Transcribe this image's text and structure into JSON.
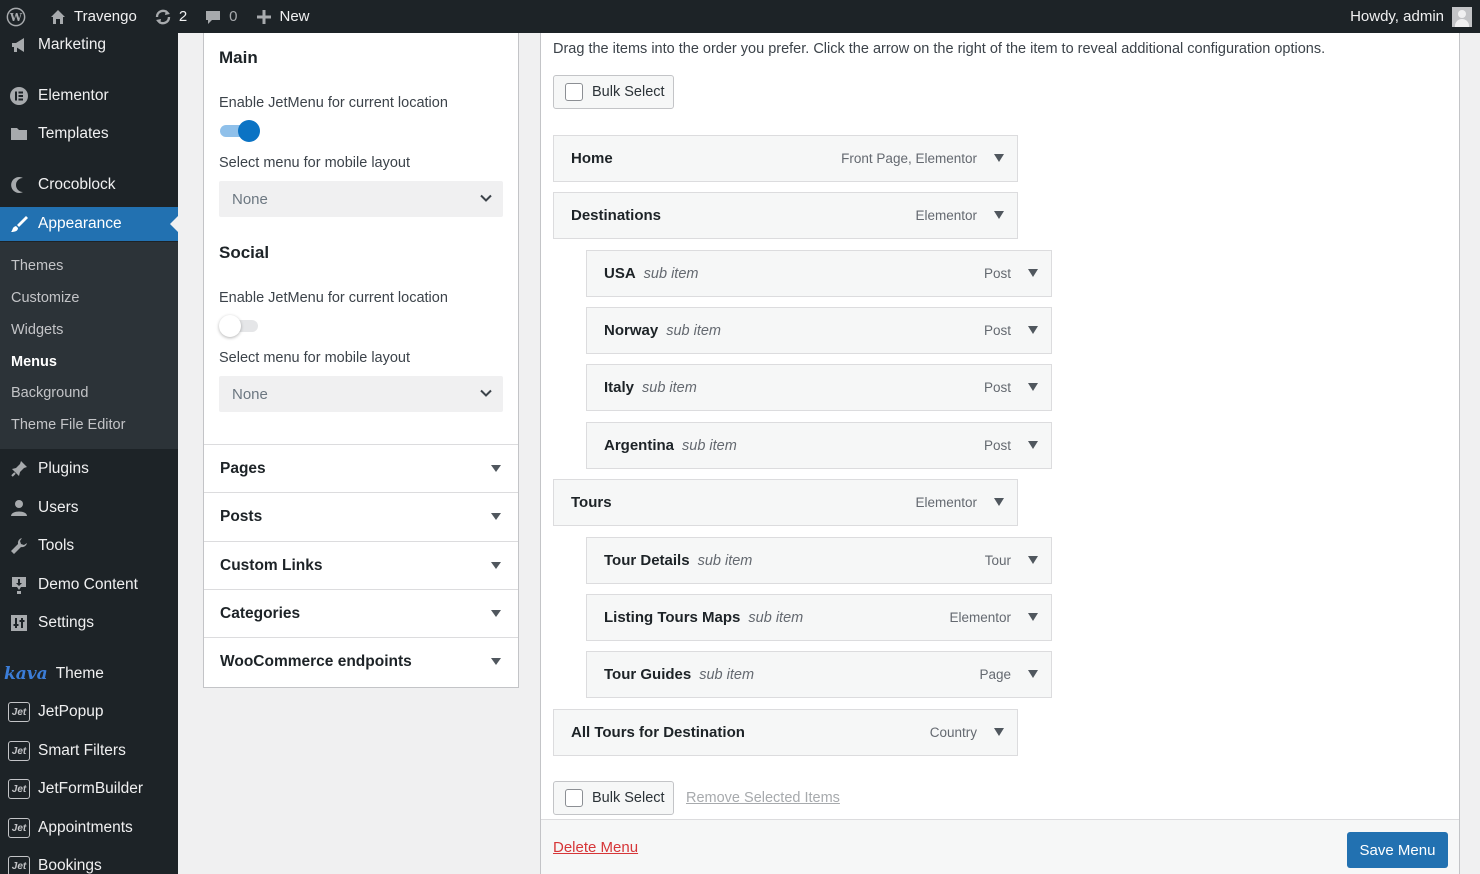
{
  "adminbar": {
    "site_name": "Travengo",
    "updates_count": "2",
    "comments_count": "0",
    "new_label": "New",
    "greeting": "Howdy, admin"
  },
  "sidebar": {
    "items": [
      {
        "label": "Marketing",
        "icon": "megaphone-icon"
      },
      {
        "label": "Elementor",
        "icon": "elementor-icon"
      },
      {
        "label": "Templates",
        "icon": "folder-icon"
      },
      {
        "label": "Crocoblock",
        "icon": "crocoblock-icon"
      },
      {
        "label": "Appearance",
        "icon": "paintbrush-icon"
      },
      {
        "label": "Plugins",
        "icon": "plugin-icon"
      },
      {
        "label": "Users",
        "icon": "user-icon"
      },
      {
        "label": "Tools",
        "icon": "wrench-icon"
      },
      {
        "label": "Demo Content",
        "icon": "download-icon"
      },
      {
        "label": "Settings",
        "icon": "settings-icon"
      },
      {
        "label": "Theme",
        "logo": "kava"
      },
      {
        "label": "JetPopup",
        "badge": "Jet"
      },
      {
        "label": "Smart Filters",
        "badge": "Jet"
      },
      {
        "label": "JetFormBuilder",
        "badge": "Jet"
      },
      {
        "label": "Appointments",
        "badge": "Jet"
      },
      {
        "label": "Bookings",
        "badge": "Jet"
      }
    ],
    "submenu": [
      "Themes",
      "Customize",
      "Widgets",
      "Menus",
      "Background",
      "Theme File Editor"
    ],
    "active": "Appearance",
    "current_sub": "Menus"
  },
  "locations": [
    {
      "title": "Main",
      "enable_label": "Enable JetMenu for current location",
      "enabled": true,
      "mobile_label": "Select menu for mobile layout",
      "mobile_value": "None"
    },
    {
      "title": "Social",
      "enable_label": "Enable JetMenu for current location",
      "enabled": false,
      "mobile_label": "Select menu for mobile layout",
      "mobile_value": "None"
    }
  ],
  "accordion": [
    "Pages",
    "Posts",
    "Custom Links",
    "Categories",
    "WooCommerce endpoints"
  ],
  "menu_editor": {
    "instructions": "Drag the items into the order you prefer. Click the arrow on the right of the item to reveal additional configuration options.",
    "bulk_select_label": "Bulk Select",
    "remove_selected_label": "Remove Selected Items",
    "delete_menu_label": "Delete Menu",
    "save_menu_label": "Save Menu",
    "items": [
      {
        "title": "Home",
        "sub": "",
        "type": "Front Page, Elementor",
        "depth": 0
      },
      {
        "title": "Destinations",
        "sub": "",
        "type": "Elementor",
        "depth": 0
      },
      {
        "title": "USA",
        "sub": "sub item",
        "type": "Post",
        "depth": 1
      },
      {
        "title": "Norway",
        "sub": "sub item",
        "type": "Post",
        "depth": 1
      },
      {
        "title": "Italy",
        "sub": "sub item",
        "type": "Post",
        "depth": 1
      },
      {
        "title": "Argentina",
        "sub": "sub item",
        "type": "Post",
        "depth": 1
      },
      {
        "title": "Tours",
        "sub": "",
        "type": "Elementor",
        "depth": 0
      },
      {
        "title": "Tour Details",
        "sub": "sub item",
        "type": "Tour",
        "depth": 1
      },
      {
        "title": "Listing Tours Maps",
        "sub": "sub item",
        "type": "Elementor",
        "depth": 1
      },
      {
        "title": "Tour Guides",
        "sub": "sub item",
        "type": "Page",
        "depth": 1
      },
      {
        "title": "All Tours for Destination",
        "sub": "",
        "type": "Country",
        "depth": 0
      }
    ]
  },
  "colors": {
    "adminbar_bg": "#1d2327",
    "accent": "#2271b1",
    "toggle_on": "#0b73c4",
    "danger": "#d63638"
  }
}
